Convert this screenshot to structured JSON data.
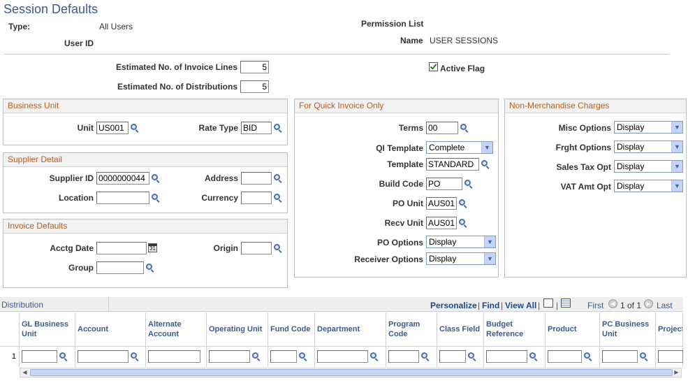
{
  "page": {
    "title": "Session Defaults",
    "type_label": "Type:",
    "type_value": "All Users",
    "userid_label": "User ID",
    "permission_list_label": "Permission List",
    "name_label": "Name",
    "name_value": "USER SESSIONS",
    "est_invoice_lines_label": "Estimated No. of Invoice Lines",
    "est_invoice_lines_value": "5",
    "est_distributions_label": "Estimated No. of Distributions",
    "est_distributions_value": "5",
    "active_flag_label": "Active Flag",
    "active_flag_checked": true
  },
  "business_unit": {
    "header": "Business Unit",
    "unit_label": "Unit",
    "unit_value": "US001",
    "rate_type_label": "Rate Type",
    "rate_type_value": "BID"
  },
  "supplier_detail": {
    "header": "Supplier Detail",
    "supplier_id_label": "Supplier ID",
    "supplier_id_value": "0000000044",
    "address_label": "Address",
    "address_value": "",
    "location_label": "Location",
    "location_value": "",
    "currency_label": "Currency",
    "currency_value": ""
  },
  "invoice_defaults": {
    "header": "Invoice Defaults",
    "acctg_date_label": "Acctg Date",
    "acctg_date_value": "",
    "origin_label": "Origin",
    "origin_value": "",
    "group_label": "Group",
    "group_value": "",
    "calendar_glyph": "31"
  },
  "quick_invoice": {
    "header": "For Quick Invoice Only",
    "terms_label": "Terms",
    "terms_value": "00",
    "qi_template_label": "QI Template",
    "qi_template_value": "Complete",
    "template_label": "Template",
    "template_value": "STANDARD",
    "build_code_label": "Build Code",
    "build_code_value": "PO",
    "po_unit_label": "PO Unit",
    "po_unit_value": "AUS01",
    "recv_unit_label": "Recv Unit",
    "recv_unit_value": "AUS01",
    "po_options_label": "PO Options",
    "po_options_value": "Display",
    "receiver_options_label": "Receiver Options",
    "receiver_options_value": "Display"
  },
  "non_merch": {
    "header": "Non-Merchandise Charges",
    "misc_label": "Misc Options",
    "misc_value": "Display",
    "frght_label": "Frght Options",
    "frght_value": "Display",
    "sales_tax_label": "Sales Tax Opt",
    "sales_tax_value": "Display",
    "vat_label": "VAT Amt Opt",
    "vat_value": "Display"
  },
  "distribution": {
    "title": "Distribution",
    "personalize": "Personalize",
    "find": "Find",
    "view_all": "View All",
    "first": "First",
    "page_info": "1 of 1",
    "last": "Last",
    "row_number": "1",
    "columns": [
      "GL Business Unit",
      "Account",
      "Alternate Account",
      "Operating Unit",
      "Fund Code",
      "Department",
      "Program Code",
      "Class Field",
      "Budget Reference",
      "Product",
      "PC Business Unit",
      "Project"
    ]
  },
  "icons": {
    "lookup": "magnifier-icon",
    "calendar": "calendar-icon",
    "dropdown": "dropdown-arrow-icon",
    "new_window": "new-window-icon",
    "grid": "download-grid-icon",
    "prev": "previous-arrow-icon",
    "next": "next-arrow-icon",
    "check": "checkbox-checked-icon"
  },
  "colors": {
    "title": "#3c5a8c",
    "group_header_text": "#b75c1c",
    "link": "#1c4a8c"
  }
}
